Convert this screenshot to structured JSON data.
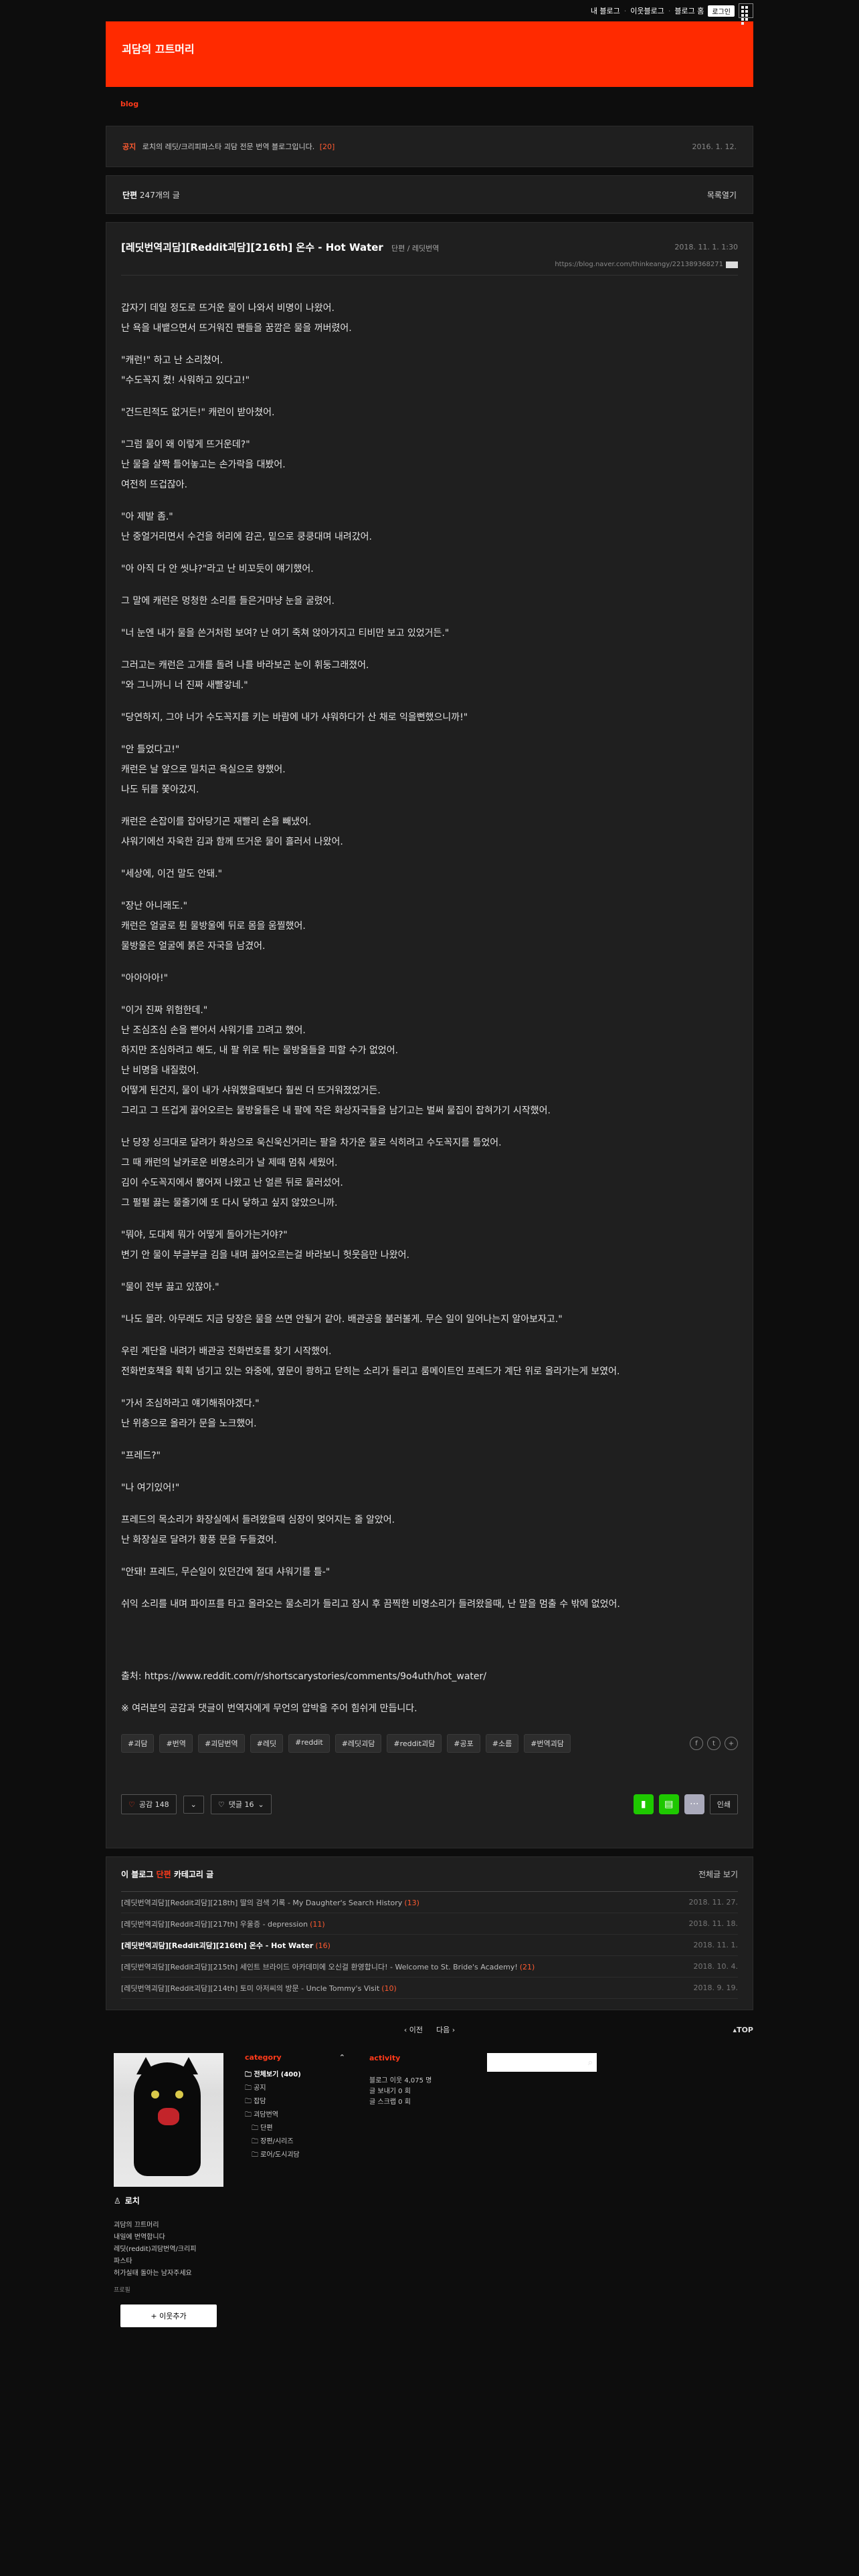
{
  "topbar": {
    "blog_home": "내 블로그",
    "neighbors": "이웃블로그",
    "blog_home2": "블로그 홈",
    "login": "로그인"
  },
  "header": {
    "title": "괴담의 끄트머리"
  },
  "nav": {
    "blog": "blog"
  },
  "notice": {
    "tag": "공지",
    "text": "로치의 레딧/크리피파스타 괴담 전문 번역 블로그입니다.",
    "count": "[20]",
    "date": "2016. 1. 12."
  },
  "category_header": {
    "name": "단편",
    "count": "247개의 글",
    "list_button": "목록열기"
  },
  "post": {
    "title": "[레딧번역괴담][Reddit괴담][216th] 온수 - Hot Water",
    "category": "단편 / 레딧번역",
    "date": "2018. 11. 1. 1:30",
    "url": "https://blog.naver.com/thinkeangy/221389368271",
    "paragraphs": [
      [
        "갑자기 데일 정도로 뜨거운 물이 나와서 비명이 나왔어.",
        "난 욕을 내뱉으면서 뜨거워진 팬들을 꿈깜은 물을 꺼버렸어."
      ],
      [
        "\"캐런!\" 하고 난 소리쳤어.",
        "\"수도꼭지 켰! 사워하고 있다고!\""
      ],
      [
        "\"건드린적도 없거든!\" 캐런이 받아쳤어."
      ],
      [
        "\"그럼 물이 왜 이렇게 뜨거운데?\"",
        "난 물을 살짝 틀어놓고는 손가락을 대봤어.",
        "여전히 뜨겁잖아."
      ],
      [
        "\"아 제발 좀.\"",
        "난 중얼거리면서 수건을 허리에 감곤, 밑으로 쿵쿵대며 내려갔어."
      ],
      [
        "\"아 아직 다 안 씻냐?\"라고 난 비꼬듯이 얘기했어."
      ],
      [
        "그 말에 캐런은 멍청한 소리를 들은거마냥 눈을 굴렸어."
      ],
      [
        "\"너 눈엔 내가 물을 쓴거처럼 보여? 난 여기 죽쳐 앉아가지고 티비만 보고 있었거든.\""
      ],
      [
        "그러고는 캐런은 고개를 돌려 나를 바라보곤 눈이 휘둥그래졌어.",
        "\"와 그니까니 너 진짜 새빨갛네.\""
      ],
      [
        "\"당연하지, 그야 너가 수도꼭지를 키는 바람에 내가 샤워하다가 산 채로 익을뻔했으니까!\""
      ],
      [
        "\"안 틀었다고!\"",
        "캐런은 날 앞으로 밀치곤 욕실으로 향했어.",
        "나도 뒤를 쫓아갔지."
      ],
      [
        "캐런은 손잡이를 잡아당기곤 재빨리 손을 빼냈어.",
        "샤워기에선 자욱한 김과 함께 뜨거운 물이 흘러서 나왔어."
      ],
      [
        "\"세상에, 이건 말도 안돼.\""
      ],
      [
        "\"장난 아니래도.\"",
        "캐런은 얼굴로 튄 물방울에 뒤로 몸을 움찔했어.",
        "물방울은 얼굴에 붉은 자국을 남겼어."
      ],
      [
        "\"아아아아!\""
      ],
      [
        "\"이거 진짜 위험한데.\"",
        "난 조심조심 손을 뻗어서 샤워기를 끄려고 했어.",
        "하지만 조심하려고 해도, 내 팔 위로 튀는 물방울들을 피할 수가 없었어.",
        "난 비명을 내질렀어.",
        "어떻게 된건지, 물이 내가 샤워했을때보다 훨씬 더 뜨거워졌었거든.",
        "그리고 그 뜨겁게 끓어오르는 물방울들은 내 팔에 작은 화상자국들을 남기고는 벌써 물집이 잡혀가기 시작했어."
      ],
      [
        "난 당장 싱크대로 달려가 화상으로 욱신욱신거리는 팔을 차가운 물로 식히려고 수도꼭지를 틀었어.",
        "그 때 캐런의 날카로운 비명소리가 날 제때 멈춰 세웠어.",
        "김이 수도꼭지에서 뿜어져 나왔고 난 얼른 뒤로 물러섰어.",
        "그 펄펄 끓는 물줄기에 또 다시 닿하고 싶지 않았으니까."
      ],
      [
        "\"뭐야, 도대체 뭐가 어떻게 돌아가는거야?\"",
        "변기 안 물이 부글부글 김을 내며 끓어오르는걸 바라보니 헛웃음만 나왔어."
      ],
      [
        "\"물이 전부 끓고 있잖아.\""
      ],
      [
        "\"나도 몰라. 아무래도 지금 당장은 물을 쓰면 안될거 같아. 배관공을 불러볼게. 무슨 일이 일어나는지 알아보자고.\""
      ],
      [
        "우린 계단을 내려가 배관공 전화번호를 찾기 시작했어.",
        "전화번호책을 휙휙 넘기고 있는 와중에, 옆문이 쾅하고 닫히는 소리가 들리고 룸메이트인 프레드가 계단 위로 올라가는게 보였어."
      ],
      [
        "\"가서 조심하라고 얘기해줘야겠다.\"",
        "난 위층으로 올라가 문을 노크했어."
      ],
      [
        "\"프레드?\""
      ],
      [
        "\"나 여기있어!\""
      ],
      [
        "프레드의 목소리가 화장실에서 들려왔을때 심장이 멎어지는 줄 알았어.",
        "난 화장실로 달려가 황풍 문을 두들겼어."
      ],
      [
        "\"안돼! 프레드, 무슨일이 있던간에 절대 샤워기를 틀-\""
      ],
      [
        "쉬익 소리를 내며 파이프를 타고 올라오는 물소리가 들리고 잠시 후 끔찍한 비명소리가 들려왔을때, 난 말을 멈출 수 밖에 없었어."
      ]
    ],
    "source_label": "출처: https://www.reddit.com/r/shortscarystories/comments/9o4uth/hot_water/",
    "footnote": "※ 여러분의 공감과 댓글이 번역자에게 무언의 압박을 주어 힘쉬게 만듭니다.",
    "tags": [
      "#괴담",
      "#번역",
      "#괴담번역",
      "#레딧",
      "#reddit",
      "#레딧괴담",
      "#reddit괴담",
      "#공포",
      "#소름",
      "#번역괴담"
    ],
    "like_label": "공감 148",
    "comment_label": "댓글 16",
    "more_label": "···",
    "stats_label": "인쇄"
  },
  "related": {
    "heading_prefix": "이 블로그",
    "heading_cat": "단편",
    "heading_suffix": "카테고리 글",
    "all_label": "전체글 보기",
    "items": [
      {
        "title": "[레딧번역괴담][Reddit괴담][218th] 딸의 검색 기록 - My Daughter's Search History",
        "count": "(13)",
        "date": "2018. 11. 27."
      },
      {
        "title": "[레딧번역괴담][Reddit괴담][217th] 우울증 - depression",
        "count": "(11)",
        "date": "2018. 11. 18."
      },
      {
        "title": "[레딧번역괴담][Reddit괴담][216th] 온수 - Hot Water",
        "count": "(16)",
        "date": "2018. 11. 1."
      },
      {
        "title": "[레딧번역괴담][Reddit괴담][215th] 세인트 브라이드 아카데미에 오신걸 환영합니다! - Welcome to St. Bride's Academy!",
        "count": "(21)",
        "date": "2018. 10. 4."
      },
      {
        "title": "[레딧번역괴담][Reddit괴담][214th] 토미 아저씨의 방문 - Uncle Tommy's Visit",
        "count": "(10)",
        "date": "2018. 9. 19."
      }
    ]
  },
  "pager": {
    "prev": "이전",
    "next": "다음",
    "top": "TOP"
  },
  "profile": {
    "name": "로치",
    "desc": [
      "괴담의 끄트머리",
      "내일에 번역합니다",
      "레딧(reddit)괴담번역/크리피",
      "파스타",
      "허가실태 돌아는 남자주세요"
    ],
    "more": "프로필",
    "neighbor_button": "+ 이웃추가"
  },
  "categories": {
    "heading": "category",
    "items": [
      {
        "label": "전체보기 (400)"
      },
      {
        "label": "공지"
      },
      {
        "label": "잡담"
      },
      {
        "label": "괴담번역"
      },
      {
        "label": "단편"
      },
      {
        "label": "장편/시리즈"
      },
      {
        "label": "로어/도시괴담"
      }
    ]
  },
  "activity": {
    "heading": "activity",
    "lines": [
      "블로그 이웃 4,075 명",
      "글 보내기 0 회",
      "글 스크랩 0 회"
    ]
  }
}
